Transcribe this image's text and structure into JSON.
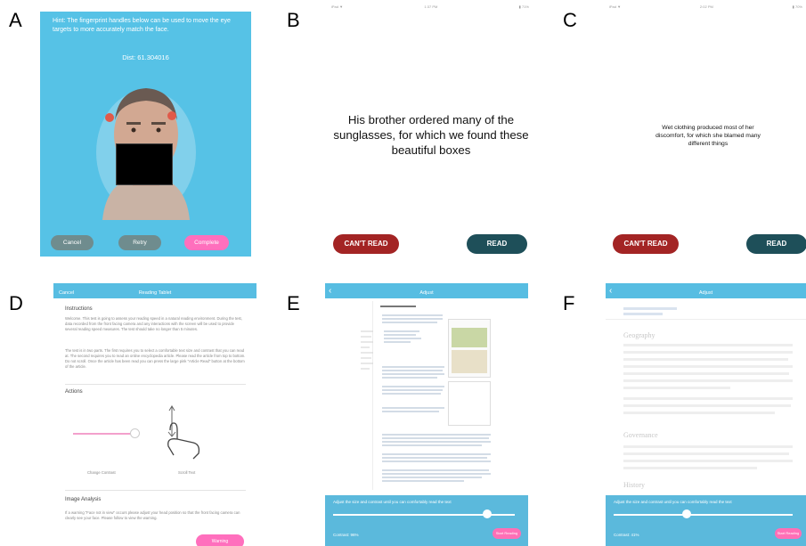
{
  "labels": {
    "a": "A",
    "b": "B",
    "c": "C",
    "d": "D",
    "e": "E",
    "f": "F"
  },
  "panelA": {
    "hint": "Hint: The fingerprint handles below can be used to move the eye targets to more accurately match the face.",
    "dist": "Dist: 61.304016",
    "cancel": "Cancel",
    "retry": "Retry",
    "complete": "Complete"
  },
  "panelB": {
    "sentence": "His brother ordered many of the sunglasses, for which we found  these beautiful boxes",
    "cant": "CAN'T READ",
    "read": "READ"
  },
  "panelC": {
    "sentence": "Wet clothing produced most of her discomfort, for which she blamed many different things",
    "cant": "CAN'T READ",
    "read": "READ"
  },
  "panelD": {
    "cancel": "Cancel",
    "title": "Reading Tablet",
    "instructions_h": "Instructions",
    "p1": "Welcome. This test is going to assess your reading speed in a natural reading environment. During the test, data recorded from the front facing camera and any interactions with the screen will be used to provide several reading speed measures. The test should take no longer than 5 minutes.",
    "p2": "The test is in two parts. The first requires you to select a comfortable text size and contrast that you can read at. The second requires you to read an online encyclopedia article. Please read the article from top to bottom. Do not scroll. Once the article has been read you can press the large pink \"Article Read\" button at the bottom of the article.",
    "actions_h": "Actions",
    "change_contrast": "Change Contrast",
    "scroll_text": "Scroll Text",
    "image_h": "Image Analysis",
    "p3": "If a warning \"Face not in view\" occurs please adjust your head position so that the front facing camera can clearly see your face. Please follow to view the warning.",
    "warning": "Warning"
  },
  "panelE": {
    "title": "Adjust",
    "adjust_text": "Adjust the size and contrast until you can comfortably read the text",
    "contrast": "Contrast: 96%",
    "start": "Start Reading",
    "slider_pos": 0.85
  },
  "panelF": {
    "title": "Adjust",
    "adjust_text": "Adjust the size and contrast until you can comfortably read the text",
    "contrast": "Contrast: 41%",
    "start": "Start Reading",
    "slider_pos": 0.41,
    "h_geo": "Geography",
    "h_gov": "Governance",
    "h_hist": "History",
    "edit": "[ edit ]"
  }
}
